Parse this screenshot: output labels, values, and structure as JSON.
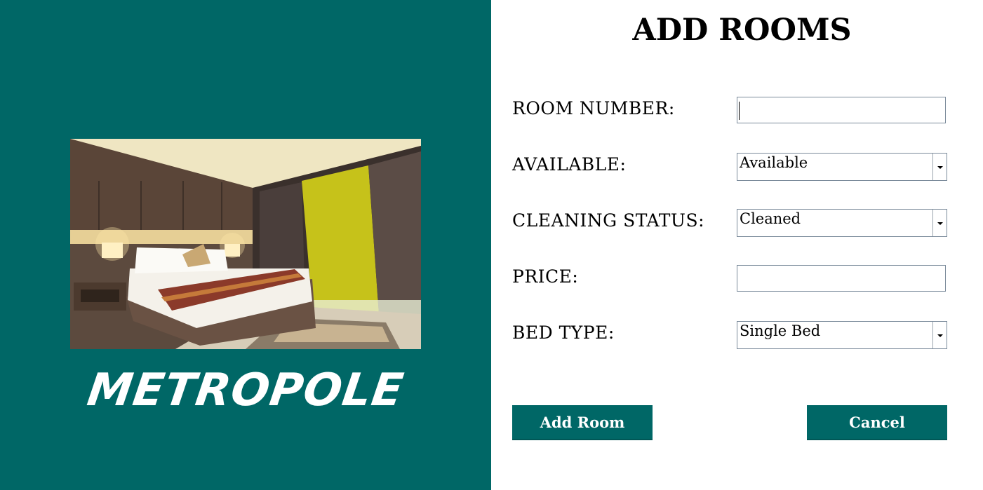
{
  "brand": {
    "name": "METROPOLE"
  },
  "form": {
    "title": "ADD ROOMS",
    "room_number": {
      "label": "ROOM NUMBER:",
      "value": ""
    },
    "available": {
      "label": "AVAILABLE:",
      "selected": "Available"
    },
    "cleaning_status": {
      "label": "CLEANING STATUS:",
      "selected": "Cleaned"
    },
    "price": {
      "label": "PRICE:",
      "value": ""
    },
    "bed_type": {
      "label": "BED TYPE:",
      "selected": "Single Bed"
    }
  },
  "buttons": {
    "add_room": "Add Room",
    "cancel": "Cancel"
  },
  "colors": {
    "brand_teal": "#006766",
    "white": "#ffffff"
  }
}
